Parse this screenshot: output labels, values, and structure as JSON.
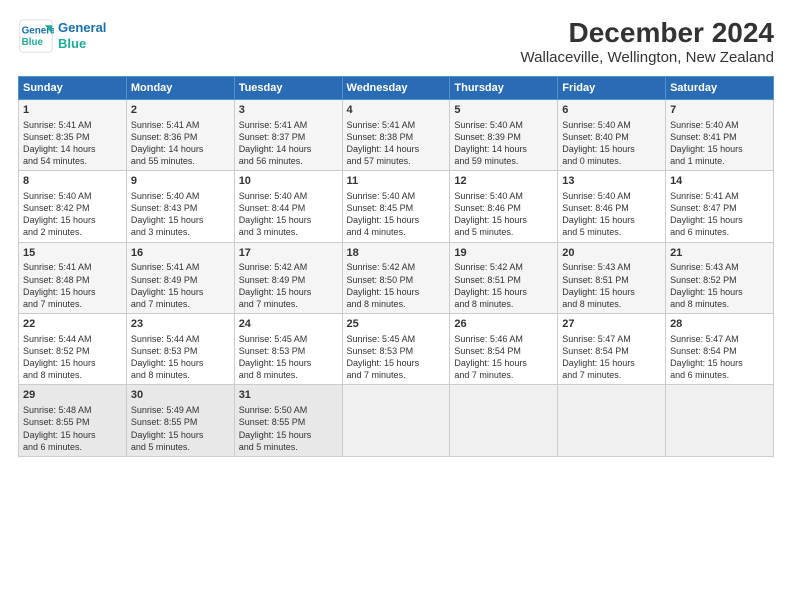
{
  "header": {
    "logo_line1": "General",
    "logo_line2": "Blue",
    "title": "December 2024",
    "subtitle": "Wallaceville, Wellington, New Zealand"
  },
  "days_of_week": [
    "Sunday",
    "Monday",
    "Tuesday",
    "Wednesday",
    "Thursday",
    "Friday",
    "Saturday"
  ],
  "weeks": [
    [
      {
        "day": 1,
        "lines": [
          "Sunrise: 5:41 AM",
          "Sunset: 8:35 PM",
          "Daylight: 14 hours",
          "and 54 minutes."
        ]
      },
      {
        "day": 2,
        "lines": [
          "Sunrise: 5:41 AM",
          "Sunset: 8:36 PM",
          "Daylight: 14 hours",
          "and 55 minutes."
        ]
      },
      {
        "day": 3,
        "lines": [
          "Sunrise: 5:41 AM",
          "Sunset: 8:37 PM",
          "Daylight: 14 hours",
          "and 56 minutes."
        ]
      },
      {
        "day": 4,
        "lines": [
          "Sunrise: 5:41 AM",
          "Sunset: 8:38 PM",
          "Daylight: 14 hours",
          "and 57 minutes."
        ]
      },
      {
        "day": 5,
        "lines": [
          "Sunrise: 5:40 AM",
          "Sunset: 8:39 PM",
          "Daylight: 14 hours",
          "and 59 minutes."
        ]
      },
      {
        "day": 6,
        "lines": [
          "Sunrise: 5:40 AM",
          "Sunset: 8:40 PM",
          "Daylight: 15 hours",
          "and 0 minutes."
        ]
      },
      {
        "day": 7,
        "lines": [
          "Sunrise: 5:40 AM",
          "Sunset: 8:41 PM",
          "Daylight: 15 hours",
          "and 1 minute."
        ]
      }
    ],
    [
      {
        "day": 8,
        "lines": [
          "Sunrise: 5:40 AM",
          "Sunset: 8:42 PM",
          "Daylight: 15 hours",
          "and 2 minutes."
        ]
      },
      {
        "day": 9,
        "lines": [
          "Sunrise: 5:40 AM",
          "Sunset: 8:43 PM",
          "Daylight: 15 hours",
          "and 3 minutes."
        ]
      },
      {
        "day": 10,
        "lines": [
          "Sunrise: 5:40 AM",
          "Sunset: 8:44 PM",
          "Daylight: 15 hours",
          "and 3 minutes."
        ]
      },
      {
        "day": 11,
        "lines": [
          "Sunrise: 5:40 AM",
          "Sunset: 8:45 PM",
          "Daylight: 15 hours",
          "and 4 minutes."
        ]
      },
      {
        "day": 12,
        "lines": [
          "Sunrise: 5:40 AM",
          "Sunset: 8:46 PM",
          "Daylight: 15 hours",
          "and 5 minutes."
        ]
      },
      {
        "day": 13,
        "lines": [
          "Sunrise: 5:40 AM",
          "Sunset: 8:46 PM",
          "Daylight: 15 hours",
          "and 5 minutes."
        ]
      },
      {
        "day": 14,
        "lines": [
          "Sunrise: 5:41 AM",
          "Sunset: 8:47 PM",
          "Daylight: 15 hours",
          "and 6 minutes."
        ]
      }
    ],
    [
      {
        "day": 15,
        "lines": [
          "Sunrise: 5:41 AM",
          "Sunset: 8:48 PM",
          "Daylight: 15 hours",
          "and 7 minutes."
        ]
      },
      {
        "day": 16,
        "lines": [
          "Sunrise: 5:41 AM",
          "Sunset: 8:49 PM",
          "Daylight: 15 hours",
          "and 7 minutes."
        ]
      },
      {
        "day": 17,
        "lines": [
          "Sunrise: 5:42 AM",
          "Sunset: 8:49 PM",
          "Daylight: 15 hours",
          "and 7 minutes."
        ]
      },
      {
        "day": 18,
        "lines": [
          "Sunrise: 5:42 AM",
          "Sunset: 8:50 PM",
          "Daylight: 15 hours",
          "and 8 minutes."
        ]
      },
      {
        "day": 19,
        "lines": [
          "Sunrise: 5:42 AM",
          "Sunset: 8:51 PM",
          "Daylight: 15 hours",
          "and 8 minutes."
        ]
      },
      {
        "day": 20,
        "lines": [
          "Sunrise: 5:43 AM",
          "Sunset: 8:51 PM",
          "Daylight: 15 hours",
          "and 8 minutes."
        ]
      },
      {
        "day": 21,
        "lines": [
          "Sunrise: 5:43 AM",
          "Sunset: 8:52 PM",
          "Daylight: 15 hours",
          "and 8 minutes."
        ]
      }
    ],
    [
      {
        "day": 22,
        "lines": [
          "Sunrise: 5:44 AM",
          "Sunset: 8:52 PM",
          "Daylight: 15 hours",
          "and 8 minutes."
        ]
      },
      {
        "day": 23,
        "lines": [
          "Sunrise: 5:44 AM",
          "Sunset: 8:53 PM",
          "Daylight: 15 hours",
          "and 8 minutes."
        ]
      },
      {
        "day": 24,
        "lines": [
          "Sunrise: 5:45 AM",
          "Sunset: 8:53 PM",
          "Daylight: 15 hours",
          "and 8 minutes."
        ]
      },
      {
        "day": 25,
        "lines": [
          "Sunrise: 5:45 AM",
          "Sunset: 8:53 PM",
          "Daylight: 15 hours",
          "and 7 minutes."
        ]
      },
      {
        "day": 26,
        "lines": [
          "Sunrise: 5:46 AM",
          "Sunset: 8:54 PM",
          "Daylight: 15 hours",
          "and 7 minutes."
        ]
      },
      {
        "day": 27,
        "lines": [
          "Sunrise: 5:47 AM",
          "Sunset: 8:54 PM",
          "Daylight: 15 hours",
          "and 7 minutes."
        ]
      },
      {
        "day": 28,
        "lines": [
          "Sunrise: 5:47 AM",
          "Sunset: 8:54 PM",
          "Daylight: 15 hours",
          "and 6 minutes."
        ]
      }
    ],
    [
      {
        "day": 29,
        "lines": [
          "Sunrise: 5:48 AM",
          "Sunset: 8:55 PM",
          "Daylight: 15 hours",
          "and 6 minutes."
        ]
      },
      {
        "day": 30,
        "lines": [
          "Sunrise: 5:49 AM",
          "Sunset: 8:55 PM",
          "Daylight: 15 hours",
          "and 5 minutes."
        ]
      },
      {
        "day": 31,
        "lines": [
          "Sunrise: 5:50 AM",
          "Sunset: 8:55 PM",
          "Daylight: 15 hours",
          "and 5 minutes."
        ]
      },
      null,
      null,
      null,
      null
    ]
  ]
}
